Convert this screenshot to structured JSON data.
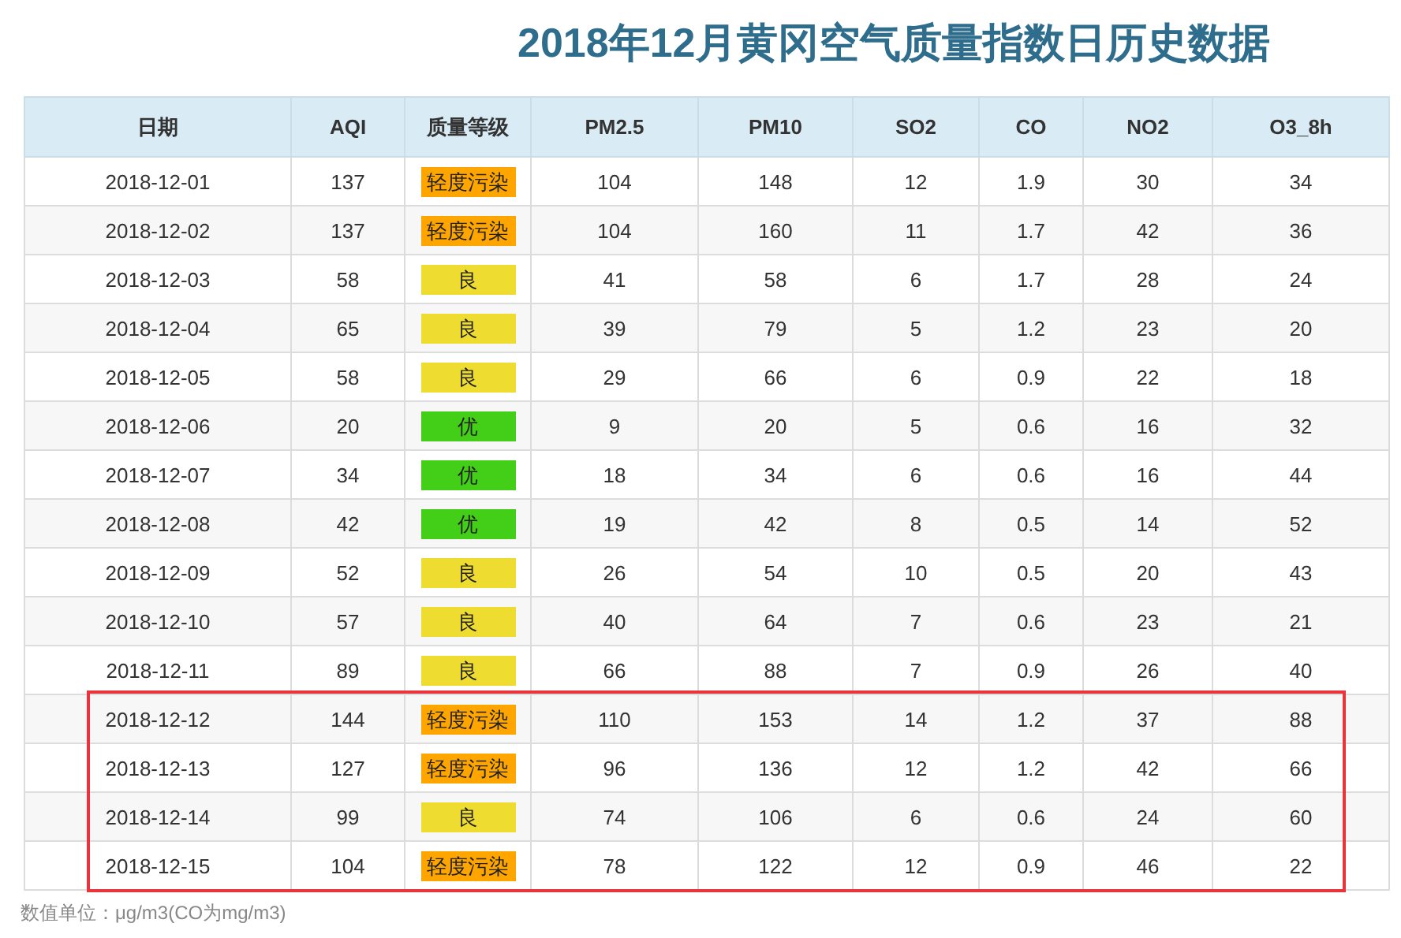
{
  "title": "2018年12月黄冈空气质量指数日历史数据",
  "table": {
    "columns": [
      "日期",
      "AQI",
      "质量等级",
      "PM2.5",
      "PM10",
      "SO2",
      "CO",
      "NO2",
      "O3_8h"
    ],
    "rows": [
      {
        "date": "2018-12-01",
        "aqi": "137",
        "quality": {
          "text": "轻度污染",
          "color": "#ffa500"
        },
        "values": [
          "104",
          "148",
          "12",
          "1.9",
          "30",
          "34"
        ],
        "highlighted": false
      },
      {
        "date": "2018-12-02",
        "aqi": "137",
        "quality": {
          "text": "轻度污染",
          "color": "#ffa500"
        },
        "values": [
          "104",
          "160",
          "11",
          "1.7",
          "42",
          "36"
        ],
        "highlighted": false
      },
      {
        "date": "2018-12-03",
        "aqi": "58",
        "quality": {
          "text": "良",
          "color": "#efdc31"
        },
        "values": [
          "41",
          "58",
          "6",
          "1.7",
          "28",
          "24"
        ],
        "highlighted": false
      },
      {
        "date": "2018-12-04",
        "aqi": "65",
        "quality": {
          "text": "良",
          "color": "#efdc31"
        },
        "values": [
          "39",
          "79",
          "5",
          "1.2",
          "23",
          "20"
        ],
        "highlighted": false
      },
      {
        "date": "2018-12-05",
        "aqi": "58",
        "quality": {
          "text": "良",
          "color": "#efdc31"
        },
        "values": [
          "29",
          "66",
          "6",
          "0.9",
          "22",
          "18"
        ],
        "highlighted": false
      },
      {
        "date": "2018-12-06",
        "aqi": "20",
        "quality": {
          "text": "优",
          "color": "#43ce17"
        },
        "values": [
          "9",
          "20",
          "5",
          "0.6",
          "16",
          "32"
        ],
        "highlighted": false
      },
      {
        "date": "2018-12-07",
        "aqi": "34",
        "quality": {
          "text": "优",
          "color": "#43ce17"
        },
        "values": [
          "18",
          "34",
          "6",
          "0.6",
          "16",
          "44"
        ],
        "highlighted": false
      },
      {
        "date": "2018-12-08",
        "aqi": "42",
        "quality": {
          "text": "优",
          "color": "#43ce17"
        },
        "values": [
          "19",
          "42",
          "8",
          "0.5",
          "14",
          "52"
        ],
        "highlighted": false
      },
      {
        "date": "2018-12-09",
        "aqi": "52",
        "quality": {
          "text": "良",
          "color": "#efdc31"
        },
        "values": [
          "26",
          "54",
          "10",
          "0.5",
          "20",
          "43"
        ],
        "highlighted": false
      },
      {
        "date": "2018-12-10",
        "aqi": "57",
        "quality": {
          "text": "良",
          "color": "#efdc31"
        },
        "values": [
          "40",
          "64",
          "7",
          "0.6",
          "23",
          "21"
        ],
        "highlighted": false
      },
      {
        "date": "2018-12-11",
        "aqi": "89",
        "quality": {
          "text": "良",
          "color": "#efdc31"
        },
        "values": [
          "66",
          "88",
          "7",
          "0.9",
          "26",
          "40"
        ],
        "highlighted": false
      },
      {
        "date": "2018-12-12",
        "aqi": "144",
        "quality": {
          "text": "轻度污染",
          "color": "#ffa500"
        },
        "values": [
          "110",
          "153",
          "14",
          "1.2",
          "37",
          "88"
        ],
        "highlighted": true
      },
      {
        "date": "2018-12-13",
        "aqi": "127",
        "quality": {
          "text": "轻度污染",
          "color": "#ffa500"
        },
        "values": [
          "96",
          "136",
          "12",
          "1.2",
          "42",
          "66"
        ],
        "highlighted": true
      },
      {
        "date": "2018-12-14",
        "aqi": "99",
        "quality": {
          "text": "良",
          "color": "#efdc31"
        },
        "values": [
          "74",
          "106",
          "6",
          "0.6",
          "24",
          "60"
        ],
        "highlighted": true
      },
      {
        "date": "2018-12-15",
        "aqi": "104",
        "quality": {
          "text": "轻度污染",
          "color": "#ffa500"
        },
        "values": [
          "78",
          "122",
          "12",
          "0.9",
          "46",
          "22"
        ],
        "highlighted": true
      }
    ]
  },
  "footnote": "数值单位：μg/m3(CO为mg/m3)"
}
